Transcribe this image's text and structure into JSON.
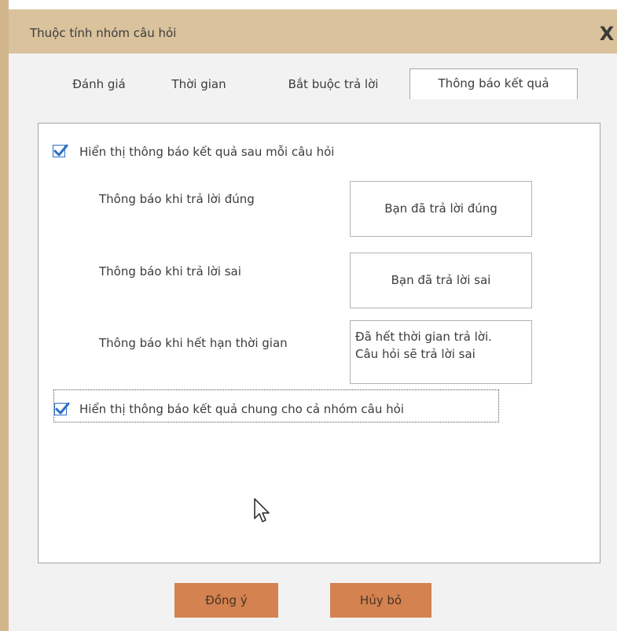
{
  "dialog": {
    "title": "Thuộc tính nhóm câu hỏi",
    "close_label": "X"
  },
  "tabs": [
    {
      "label": "Đánh giá",
      "active": false
    },
    {
      "label": "Thời gian",
      "active": false
    },
    {
      "label": "Bắt buộc trả lời",
      "active": false
    },
    {
      "label": "Thông báo kết quả",
      "active": true
    }
  ],
  "panel": {
    "show_result_each_checkbox": {
      "label": "Hiển thị thông báo kết quả sau mỗi câu hỏi",
      "checked": true
    },
    "messages": [
      {
        "label": "Thông báo khi trả lời đúng",
        "value": "Bạn đã trả lời đúng"
      },
      {
        "label": "Thông báo khi trả lời sai",
        "value": "Bạn đã trả lời sai"
      },
      {
        "label": "Thông báo khi hết hạn thời gian",
        "value_line1": "Đã hết thời gian trả lời.",
        "value_line2": "Câu hỏi sẽ trả lời sai"
      }
    ],
    "show_result_group_checkbox": {
      "label": "Hiển thị thông báo kết quả chung cho cả nhóm câu hỏi",
      "checked": true
    }
  },
  "buttons": {
    "ok_label": "Đồng ý",
    "cancel_label": "Hủy bỏ"
  },
  "colors": {
    "titlebar": "#d9c29c",
    "left_edge": "#d2b68b",
    "button": "#d38250",
    "checkbox_accent": "#2b6fc5"
  },
  "icons": {
    "close": "close-icon",
    "cursor": "mouse-pointer-icon",
    "check": "checkmark-icon"
  }
}
